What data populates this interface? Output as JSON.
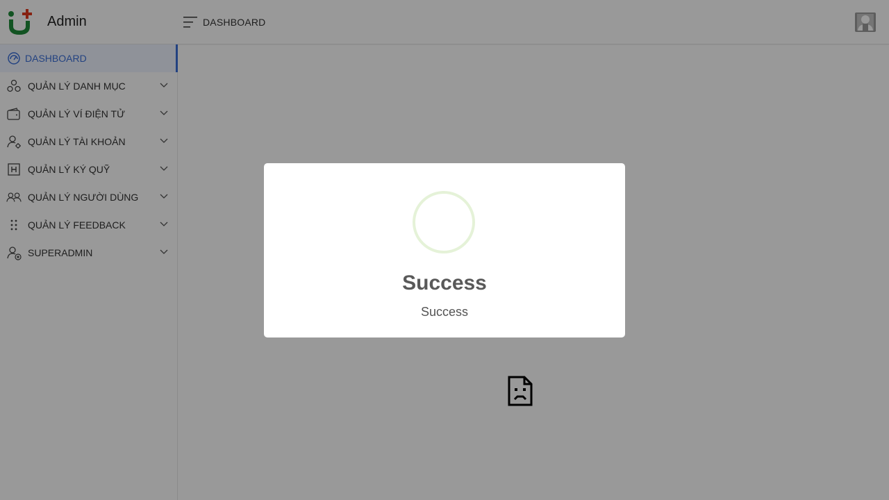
{
  "header": {
    "brand": "Admin",
    "page_title": "DASHBOARD"
  },
  "sidebar": {
    "items": [
      {
        "label": "DASHBOARD",
        "icon": "dashboard-icon",
        "active": true
      },
      {
        "label": "QUẢN LÝ DANH MỤC",
        "icon": "category-icon"
      },
      {
        "label": "QUẢN LÝ VÍ ĐIỆN TỬ",
        "icon": "wallet-icon"
      },
      {
        "label": "QUẢN LÝ TÀI KHOẢN",
        "icon": "user-settings-icon"
      },
      {
        "label": "QUẢN LÝ KÝ QUỸ",
        "icon": "h-box-icon"
      },
      {
        "label": "QUẢN LÝ NGƯỜI DÙNG",
        "icon": "users-icon"
      },
      {
        "label": "QUẢN LÝ FEEDBACK",
        "icon": "drag-dots-icon"
      },
      {
        "label": "SUPERADMIN",
        "icon": "user-add-icon"
      }
    ]
  },
  "modal": {
    "title": "Success",
    "text": "Success",
    "icon": "success-circle-icon"
  },
  "colors": {
    "accent": "#3b6fd8",
    "logo_green": "#1f8a3a",
    "logo_red": "#e03a1e",
    "success_ring": "#e5f2d8"
  }
}
